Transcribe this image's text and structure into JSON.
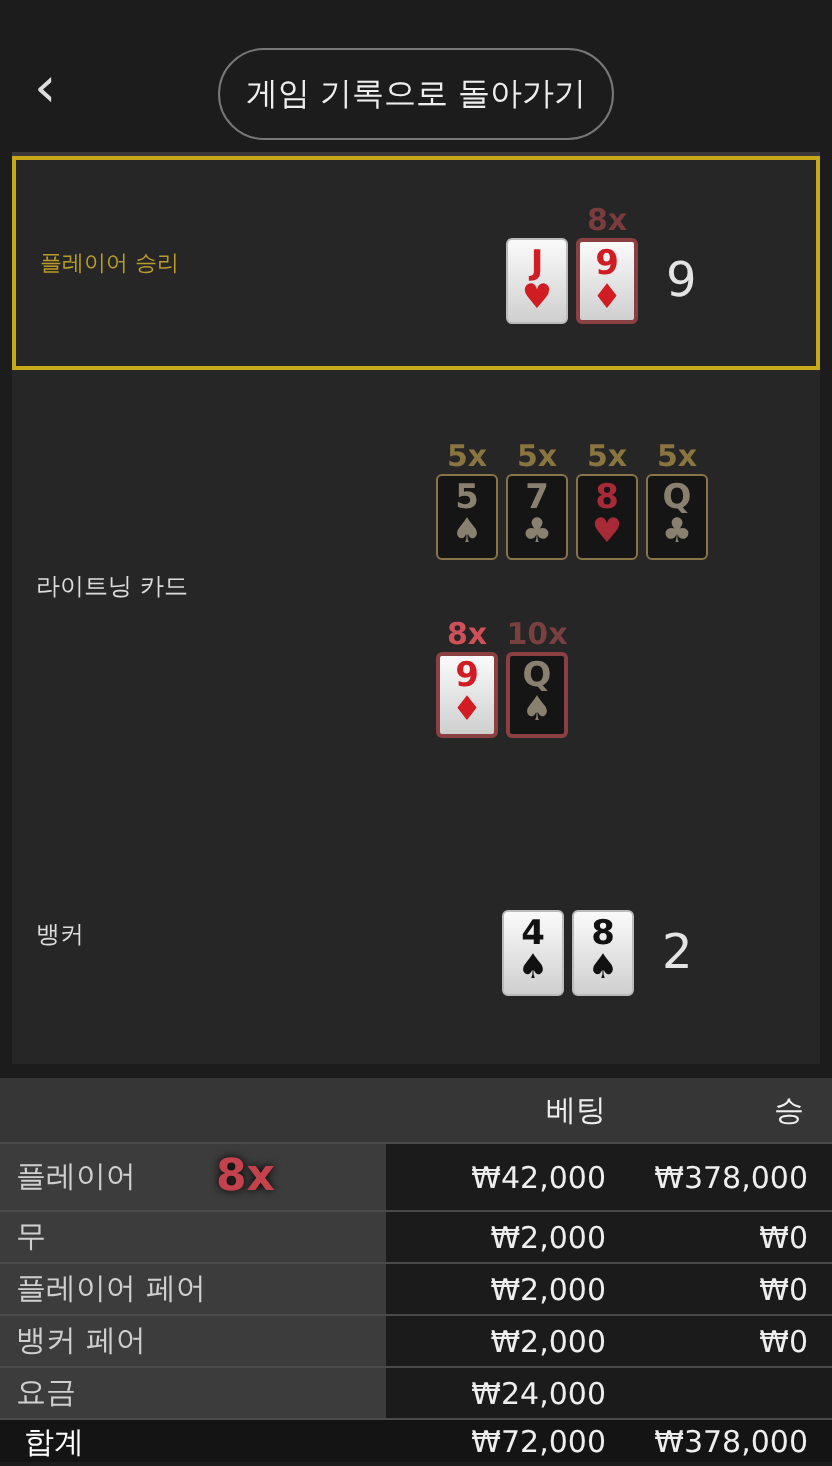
{
  "header": {
    "back_icon": "‹",
    "button": "게임 기록으로 돌아가기"
  },
  "sections": [
    {
      "kind": "hand",
      "label": "플레이어 승리",
      "winner": true,
      "score": "9",
      "card_rows": [
        [
          {
            "rank": "J",
            "suit": "♥",
            "kind": "light",
            "marked": false
          },
          {
            "rank": "9",
            "suit": "♦",
            "kind": "light",
            "marked": true,
            "multiplier": "8x",
            "color": "#7a3c3c"
          }
        ]
      ]
    },
    {
      "kind": "lightning",
      "label": "라이트닝 카드",
      "winner": false,
      "card_rows": [
        [
          {
            "rank": "5",
            "suit": "♠",
            "kind": "dark",
            "marked": false,
            "multiplier": "5x",
            "color": "#8a7440"
          },
          {
            "rank": "7",
            "suit": "♣",
            "kind": "dark",
            "marked": false,
            "multiplier": "5x",
            "color": "#8a7440"
          },
          {
            "rank": "8",
            "suit": "♥",
            "kind": "dark",
            "marked": false,
            "multiplier": "5x",
            "color": "#8a7440"
          },
          {
            "rank": "Q",
            "suit": "♣",
            "kind": "dark",
            "marked": false,
            "multiplier": "5x",
            "color": "#8a7440"
          }
        ],
        [
          {
            "rank": "9",
            "suit": "♦",
            "kind": "light",
            "marked": true,
            "multiplier": "8x",
            "color": "#d0505a"
          },
          {
            "rank": "Q",
            "suit": "♠",
            "kind": "dark",
            "marked": true,
            "multiplier": "10x",
            "color": "#7a4040"
          }
        ]
      ]
    },
    {
      "kind": "hand",
      "label": "뱅커",
      "winner": false,
      "score": "2",
      "card_rows": [
        [
          {
            "rank": "4",
            "suit": "♠",
            "kind": "light",
            "marked": false
          },
          {
            "rank": "8",
            "suit": "♠",
            "kind": "light",
            "marked": false
          }
        ]
      ]
    }
  ],
  "bets_table": {
    "columns": [
      "베팅",
      "승"
    ],
    "rows": [
      {
        "label": "플레이어",
        "multiplier": "8x",
        "bet": "₩42,000",
        "win": "₩378,000"
      },
      {
        "label": "무",
        "bet": "₩2,000",
        "win": "₩0"
      },
      {
        "label": "플레이어 페어",
        "bet": "₩2,000",
        "win": "₩0"
      },
      {
        "label": "뱅커 페어",
        "bet": "₩2,000",
        "win": "₩0"
      },
      {
        "label": "요금",
        "bet": "₩24,000"
      }
    ],
    "total": {
      "label": "합계",
      "bet": "₩72,000",
      "win": "₩378,000"
    }
  }
}
